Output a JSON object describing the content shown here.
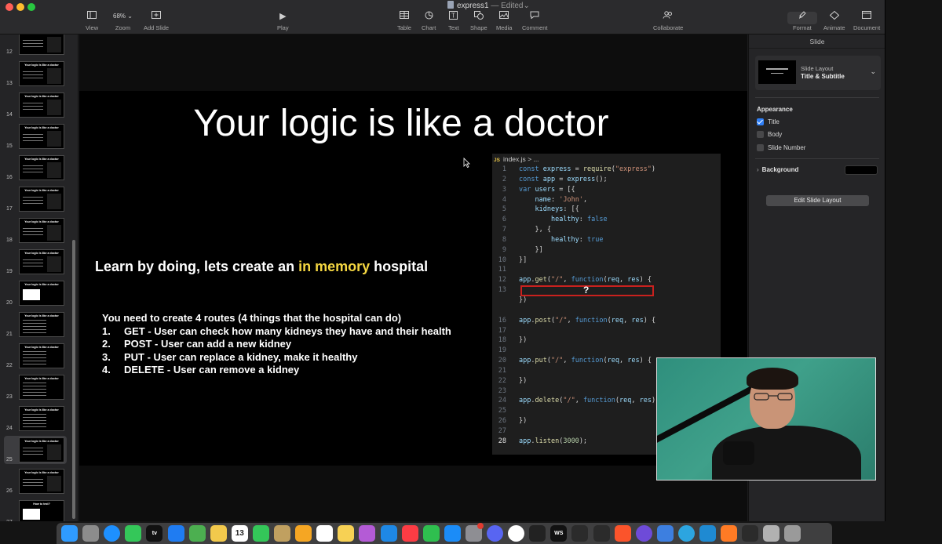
{
  "window": {
    "title": "express1",
    "status": "Edited",
    "dash": "—"
  },
  "toolbar": {
    "view": "View",
    "zoom_value": "68%",
    "zoom": "Zoom",
    "add_slide": "Add Slide",
    "play": "Play",
    "table": "Table",
    "chart": "Chart",
    "text": "Text",
    "shape": "Shape",
    "media": "Media",
    "comment": "Comment",
    "collaborate": "Collaborate",
    "format": "Format",
    "animate": "Animate",
    "document": "Document"
  },
  "sidebar": {
    "slides": [
      {
        "num": "12",
        "title": "",
        "kind": "code"
      },
      {
        "num": "13",
        "title": "Your logic is like a doctor",
        "kind": "code"
      },
      {
        "num": "14",
        "title": "Your logic is like a doctor",
        "kind": "code"
      },
      {
        "num": "15",
        "title": "Your logic is like a doctor",
        "kind": "code"
      },
      {
        "num": "16",
        "title": "Your logic is like a doctor",
        "kind": "code"
      },
      {
        "num": "17",
        "title": "Your logic is like a doctor",
        "kind": "code"
      },
      {
        "num": "18",
        "title": "Your logic is like a doctor",
        "kind": "code"
      },
      {
        "num": "19",
        "title": "Your logic is like a doctor",
        "kind": "code"
      },
      {
        "num": "20",
        "title": "Your logic is like a doctor",
        "kind": "white"
      },
      {
        "num": "21",
        "title": "Your logic is like a doctor",
        "kind": "text"
      },
      {
        "num": "22",
        "title": "Your logic is like a doctor",
        "kind": "text"
      },
      {
        "num": "23",
        "title": "Your logic is like a doctor",
        "kind": "text"
      },
      {
        "num": "24",
        "title": "Your logic is like a doctor",
        "kind": "text"
      },
      {
        "num": "25",
        "title": "Your logic is like a doctor",
        "kind": "code"
      },
      {
        "num": "26",
        "title": "Your logic is like a doctor",
        "kind": "code"
      },
      {
        "num": "27",
        "title": "How to test?",
        "kind": "white"
      }
    ],
    "selected_num": "25"
  },
  "slide": {
    "title": "Your logic is like a doctor",
    "subhead_before": "Learn by doing, lets create an ",
    "subhead_highlight": "in memory",
    "subhead_after": " hospital",
    "routes_intro": "You need to create 4 routes (4 things that the hospital can do)",
    "routes": [
      {
        "num": "1.",
        "text": "GET - User can check how many kidneys they have and their health"
      },
      {
        "num": "2.",
        "text": "POST - User can add a new kidney"
      },
      {
        "num": "3.",
        "text": "PUT - User can replace a kidney, make it healthy"
      },
      {
        "num": "4.",
        "text": "DELETE - User can remove a kidney"
      }
    ],
    "highlight_color": "#f5d742"
  },
  "code": {
    "tab_icon": "JS",
    "tab_label": "index.js > ...",
    "placeholder_mark": "?",
    "active_line": "28",
    "lines": [
      {
        "n": "1",
        "t": "const express = require(\"express\")"
      },
      {
        "n": "2",
        "t": "const app = express();"
      },
      {
        "n": "3",
        "t": "var users = [{"
      },
      {
        "n": "4",
        "t": "    name: 'John',"
      },
      {
        "n": "5",
        "t": "    kidneys: [{"
      },
      {
        "n": "6",
        "t": "        healthy: false"
      },
      {
        "n": "7",
        "t": "    }, {"
      },
      {
        "n": "8",
        "t": "        healthy: true"
      },
      {
        "n": "9",
        "t": "    }]"
      },
      {
        "n": "10",
        "t": "}]"
      },
      {
        "n": "11",
        "t": ""
      },
      {
        "n": "12",
        "t": "app.get(\"/\", function(req, res) {"
      },
      {
        "n": "13",
        "t": ""
      },
      {
        "n": "",
        "t": "})"
      },
      {
        "n": "",
        "t": ""
      },
      {
        "n": "16",
        "t": "app.post(\"/\", function(req, res) {"
      },
      {
        "n": "17",
        "t": ""
      },
      {
        "n": "18",
        "t": "})"
      },
      {
        "n": "19",
        "t": ""
      },
      {
        "n": "20",
        "t": "app.put(\"/\", function(req, res) {"
      },
      {
        "n": "21",
        "t": ""
      },
      {
        "n": "22",
        "t": "})"
      },
      {
        "n": "23",
        "t": ""
      },
      {
        "n": "24",
        "t": "app.delete(\"/\", function(req, res)"
      },
      {
        "n": "25",
        "t": ""
      },
      {
        "n": "26",
        "t": "})"
      },
      {
        "n": "27",
        "t": ""
      },
      {
        "n": "28",
        "t": "app.listen(3000);"
      }
    ]
  },
  "inspector": {
    "header": "Slide",
    "layout_label": "Slide Layout",
    "layout_value": "Title & Subtitle",
    "appearance": "Appearance",
    "title_cb": "Title",
    "body_cb": "Body",
    "slide_number_cb": "Slide Number",
    "background": "Background",
    "edit_layout": "Edit Slide Layout",
    "title_checked": true,
    "body_checked": false,
    "slide_number_checked": false
  },
  "dock": {
    "icons": [
      "finder-icon",
      "launchpad-icon",
      "safari-icon",
      "messages-icon",
      "tv-icon",
      "mail-icon",
      "maps-icon",
      "photos-icon",
      "calendar-icon",
      "facetime-icon",
      "contacts-icon",
      "keynote-icon",
      "reminders-icon",
      "notes-icon",
      "podcasts-icon",
      "keynote2-icon",
      "music-icon",
      "numbers-icon",
      "appstore-icon",
      "settings-icon",
      "discord-icon",
      "chrome-icon",
      "github-icon",
      "webstorm-icon",
      "terminal-icon",
      "terminal2-icon",
      "brave-icon",
      "arc-icon",
      "preview-icon",
      "telegram-icon",
      "vscode-icon",
      "keynote3-icon",
      "quicktime-icon",
      "gallery-icon",
      "trash-icon"
    ],
    "calendar_day": "13",
    "tv_label": "tv",
    "webstorm_label": "WS",
    "colors": [
      "#2f9bff",
      "#8c8c8c",
      "#1e90ff",
      "#34c759",
      "#111",
      "#1f7cf2",
      "#4caf50",
      "#f2c94c",
      "#ffffff",
      "#34c759",
      "#c0a060",
      "#f5a623",
      "#ffffff",
      "#f7d154",
      "#b45bd6",
      "#1e88e5",
      "#fc3c44",
      "#2fbf4f",
      "#1b8cf8",
      "#8e8e93",
      "#5865f2",
      "#ffffff",
      "#222",
      "#0b84ff",
      "#2b2b2b",
      "#2b2b2b",
      "#fb542b",
      "#6e4bd8",
      "#3d7fe0",
      "#2ca5e0",
      "#1f8ad2",
      "#ff7b25",
      "#2b2b2b",
      "#b1b1b1",
      "#9a9a9a"
    ]
  }
}
